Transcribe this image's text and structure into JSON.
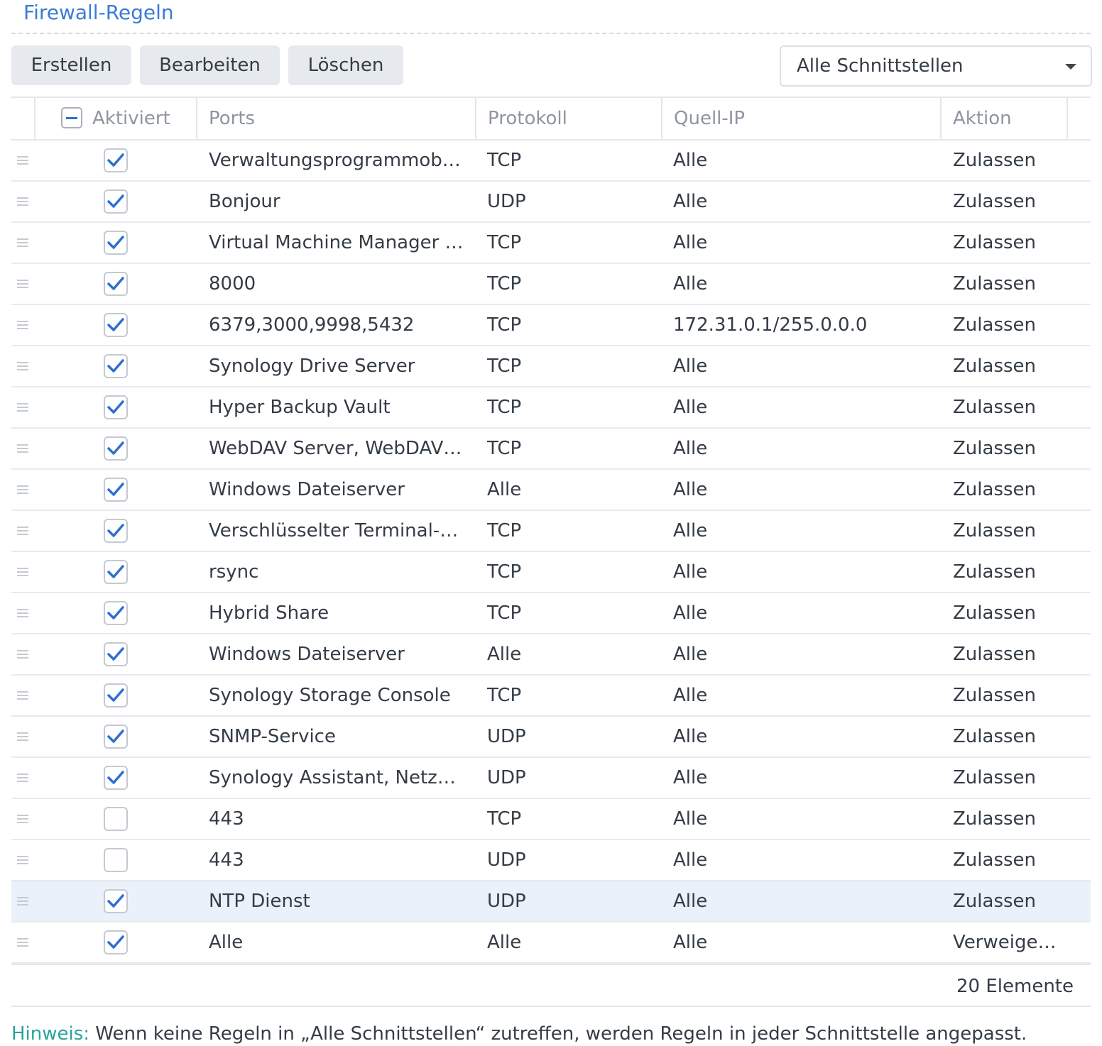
{
  "page": {
    "title": "Firewall-Regeln"
  },
  "toolbar": {
    "create_label": "Erstellen",
    "edit_label": "Bearbeiten",
    "delete_label": "Löschen",
    "interface_select": {
      "selected": "Alle Schnittstellen"
    }
  },
  "table": {
    "headers": {
      "enabled": "Aktiviert",
      "ports": "Ports",
      "protocol": "Protokoll",
      "source_ip": "Quell-IP",
      "action": "Aktion"
    },
    "rows": [
      {
        "enabled": true,
        "ports": "Verwaltungsprogrammob…",
        "protocol": "TCP",
        "source_ip": "Alle",
        "action": "Zulassen"
      },
      {
        "enabled": true,
        "ports": "Bonjour",
        "protocol": "UDP",
        "source_ip": "Alle",
        "action": "Zulassen"
      },
      {
        "enabled": true,
        "ports": "Virtual Machine Manager …",
        "protocol": "TCP",
        "source_ip": "Alle",
        "action": "Zulassen"
      },
      {
        "enabled": true,
        "ports": "8000",
        "protocol": "TCP",
        "source_ip": "Alle",
        "action": "Zulassen"
      },
      {
        "enabled": true,
        "ports": "6379,3000,9998,5432",
        "protocol": "TCP",
        "source_ip": "172.31.0.1/255.0.0.0",
        "action": "Zulassen"
      },
      {
        "enabled": true,
        "ports": "Synology Drive Server",
        "protocol": "TCP",
        "source_ip": "Alle",
        "action": "Zulassen"
      },
      {
        "enabled": true,
        "ports": "Hyper Backup Vault",
        "protocol": "TCP",
        "source_ip": "Alle",
        "action": "Zulassen"
      },
      {
        "enabled": true,
        "ports": "WebDAV Server, WebDAV…",
        "protocol": "TCP",
        "source_ip": "Alle",
        "action": "Zulassen"
      },
      {
        "enabled": true,
        "ports": "Windows Dateiserver",
        "protocol": "Alle",
        "source_ip": "Alle",
        "action": "Zulassen"
      },
      {
        "enabled": true,
        "ports": "Verschlüsselter Terminal-…",
        "protocol": "TCP",
        "source_ip": "Alle",
        "action": "Zulassen"
      },
      {
        "enabled": true,
        "ports": "rsync",
        "protocol": "TCP",
        "source_ip": "Alle",
        "action": "Zulassen"
      },
      {
        "enabled": true,
        "ports": "Hybrid Share",
        "protocol": "TCP",
        "source_ip": "Alle",
        "action": "Zulassen"
      },
      {
        "enabled": true,
        "ports": "Windows Dateiserver",
        "protocol": "Alle",
        "source_ip": "Alle",
        "action": "Zulassen"
      },
      {
        "enabled": true,
        "ports": "Synology Storage Console",
        "protocol": "TCP",
        "source_ip": "Alle",
        "action": "Zulassen"
      },
      {
        "enabled": true,
        "ports": "SNMP-Service",
        "protocol": "UDP",
        "source_ip": "Alle",
        "action": "Zulassen"
      },
      {
        "enabled": true,
        "ports": "Synology Assistant, Netz…",
        "protocol": "UDP",
        "source_ip": "Alle",
        "action": "Zulassen"
      },
      {
        "enabled": false,
        "ports": "443",
        "protocol": "TCP",
        "source_ip": "Alle",
        "action": "Zulassen"
      },
      {
        "enabled": false,
        "ports": "443",
        "protocol": "UDP",
        "source_ip": "Alle",
        "action": "Zulassen"
      },
      {
        "enabled": true,
        "ports": "NTP Dienst",
        "protocol": "UDP",
        "source_ip": "Alle",
        "action": "Zulassen",
        "selected": true
      },
      {
        "enabled": true,
        "ports": "Alle",
        "protocol": "Alle",
        "source_ip": "Alle",
        "action": "Verweige…"
      }
    ],
    "count_label": "20 Elemente"
  },
  "hint": {
    "label": "Hinweis:",
    "text": " Wenn keine Regeln in „Alle Schnittstellen“ zutreffen, werden Regeln in jeder Schnittstelle angepasst."
  },
  "icons": {
    "header_checkbox": "indeterminate-checkbox-icon",
    "row_checkbox": "checkmark-icon",
    "drag": "drag-handle-icon",
    "dropdown": "caret-down-icon"
  },
  "colors": {
    "accent": "#3a7bd5",
    "check": "#2f6fd0",
    "hint": "#2aa39a",
    "selected_row": "#eaf1fb"
  }
}
